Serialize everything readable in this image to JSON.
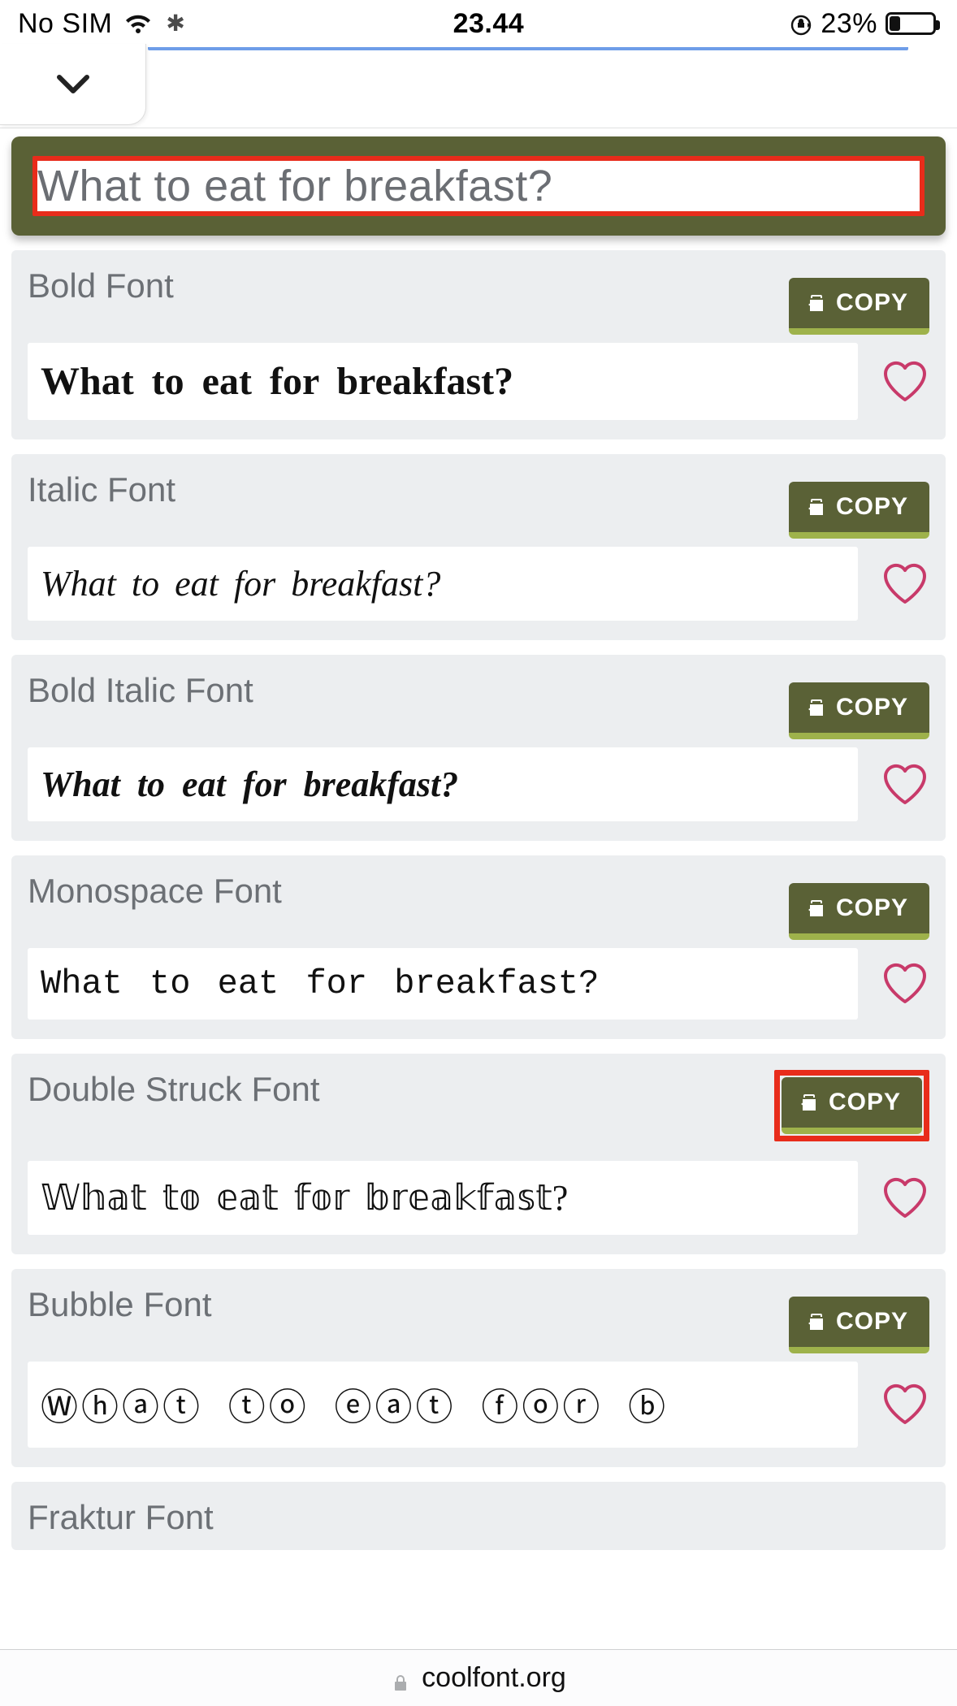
{
  "status": {
    "carrier": "No SIM",
    "time": "23.44",
    "battery_pct": "23%"
  },
  "input": {
    "value": "What to eat for breakfast?"
  },
  "copy_label": "COPY",
  "fonts": [
    {
      "name": "Bold Font",
      "output": "What to eat for breakfast?",
      "cls": "f-bold",
      "highlight_copy": false
    },
    {
      "name": "Italic Font",
      "output": "What to eat for breakfast?",
      "cls": "f-italic",
      "highlight_copy": false
    },
    {
      "name": "Bold Italic Font",
      "output": "What to eat for breakfast?",
      "cls": "f-bi",
      "highlight_copy": false
    },
    {
      "name": "Monospace Font",
      "output": "What to eat for breakfast?",
      "cls": "f-mono",
      "highlight_copy": false
    },
    {
      "name": "Double Struck Font",
      "output": "𝕎𝕙𝕒𝕥 𝕥𝕠 𝕖𝕒𝕥 𝕗𝕠𝕣 𝕓𝕣𝕖𝕒𝕜𝕗𝕒𝕤𝕥?",
      "cls": "f-ds",
      "highlight_copy": true
    },
    {
      "name": "Bubble Font",
      "output": "Ⓦⓗⓐⓣ ⓣⓞ ⓔⓐⓣ ⓕⓞⓡ ⓑ",
      "cls": "f-bubble",
      "highlight_copy": false
    }
  ],
  "cutoff_font": {
    "name": "Fraktur Font"
  },
  "url": "coolfont.org",
  "highlight_input": true
}
